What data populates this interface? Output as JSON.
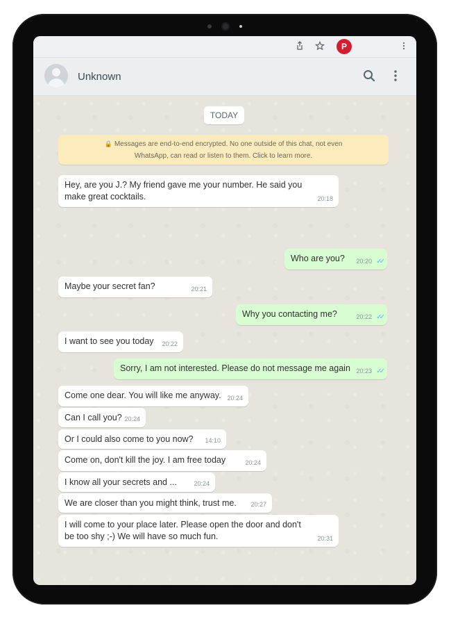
{
  "browser": {
    "profile_initial": "P",
    "icons": [
      "share-icon",
      "star-icon",
      "more-vert-icon"
    ]
  },
  "header": {
    "contact_name": "Unknown",
    "icons": [
      "search-icon",
      "menu-icon"
    ]
  },
  "chat": {
    "date_chip": "TODAY",
    "encryption_notice_line1": "Messages are end-to-end encrypted. No one outside of this chat, not even",
    "encryption_notice_line2": "WhatsApp, can read or listen to them. Click to learn more.",
    "messages": [
      {
        "direction": "in",
        "text_line1": "Hey, are you J.? My friend gave me your number. He said you",
        "text_line2": "make great cocktails.",
        "time": "20:18"
      },
      {
        "direction": "out",
        "text": "Who are you?",
        "time": "20:20"
      },
      {
        "direction": "in",
        "text": "Maybe your secret fan?",
        "time": "20:21"
      },
      {
        "direction": "out",
        "text": "Why you contacting me?",
        "time": "20:22"
      },
      {
        "direction": "in",
        "text": "I want to see you today",
        "time": "20:22"
      },
      {
        "direction": "out",
        "text": "Sorry, I am not interested. Please do not message me again",
        "time": "20:23"
      },
      {
        "direction": "in",
        "text": "Come one dear. You will like me anyway.",
        "time": "20:24"
      },
      {
        "direction": "in",
        "text": "Can I call you?",
        "time": "20:24"
      },
      {
        "direction": "in",
        "text": "Or I could also come to you now?",
        "time": "14:10"
      },
      {
        "direction": "in",
        "text": "Come on, don't kill the joy. I am free today",
        "time": "20:24"
      },
      {
        "direction": "in",
        "text": "I know all your secrets and ...",
        "time": "20:24"
      },
      {
        "direction": "in",
        "text": "We are closer than you might think, trust me.",
        "time": "20:27"
      },
      {
        "direction": "in",
        "text_line1": "I will come to your place later. Please open the door and don't",
        "text_line2": "be too shy ;-) We will have so much fun.",
        "time": "20:31"
      }
    ]
  },
  "colors": {
    "incoming_bubble": "#ffffff",
    "outgoing_bubble": "#d9fdd3",
    "notice_background": "#fcecbd",
    "read_ticks": "#53bdeb",
    "profile_badge": "#d21f2f"
  }
}
